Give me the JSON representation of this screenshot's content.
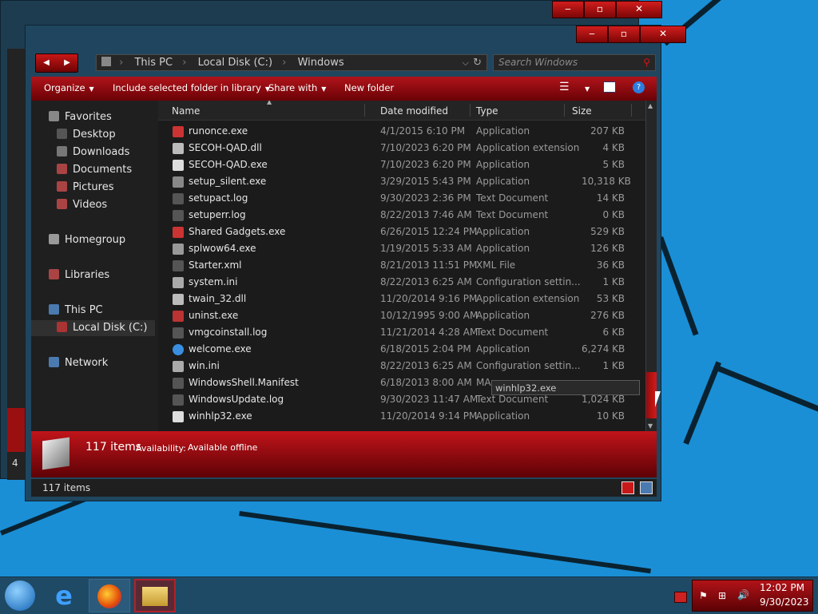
{
  "window": {
    "address": {
      "crumbs": [
        "This PC",
        "Local Disk (C:)",
        "Windows"
      ]
    },
    "search_placeholder": "Search Windows",
    "toolbar": {
      "organize": "Organize",
      "include": "Include selected folder in library",
      "share": "Share with",
      "new_folder": "New folder"
    },
    "nav": {
      "favorites": "Favorites",
      "desktop": "Desktop",
      "downloads": "Downloads",
      "documents": "Documents",
      "pictures": "Pictures",
      "videos": "Videos",
      "homegroup": "Homegroup",
      "libraries": "Libraries",
      "this_pc": "This PC",
      "local_disk": "Local Disk (C:)",
      "network": "Network"
    },
    "columns": {
      "name": "Name",
      "date": "Date modified",
      "type": "Type",
      "size": "Size"
    },
    "files": [
      {
        "name": "runonce.exe",
        "date": "4/1/2015 6:10 PM",
        "type": "Application",
        "size": "207 KB",
        "icon": "app-icon"
      },
      {
        "name": "SECOH-QAD.dll",
        "date": "7/10/2023 6:20 PM",
        "type": "Application extension",
        "size": "4 KB",
        "icon": "dll-icon"
      },
      {
        "name": "SECOH-QAD.exe",
        "date": "7/10/2023 6:20 PM",
        "type": "Application",
        "size": "5 KB",
        "icon": "window-app-icon"
      },
      {
        "name": "setup_silent.exe",
        "date": "3/29/2015 5:43 PM",
        "type": "Application",
        "size": "10,318 KB",
        "icon": "setup-icon"
      },
      {
        "name": "setupact.log",
        "date": "9/30/2023 2:36 PM",
        "type": "Text Document",
        "size": "14 KB",
        "icon": "text-icon"
      },
      {
        "name": "setuperr.log",
        "date": "8/22/2013 7:46 AM",
        "type": "Text Document",
        "size": "0 KB",
        "icon": "text-icon"
      },
      {
        "name": "Shared Gadgets.exe",
        "date": "6/26/2015 12:24 PM",
        "type": "Application",
        "size": "529 KB",
        "icon": "app-icon"
      },
      {
        "name": "splwow64.exe",
        "date": "1/19/2015 5:33 AM",
        "type": "Application",
        "size": "126 KB",
        "icon": "printer-icon"
      },
      {
        "name": "Starter.xml",
        "date": "8/21/2013 11:51 PM",
        "type": "XML File",
        "size": "36 KB",
        "icon": "text-icon"
      },
      {
        "name": "system.ini",
        "date": "8/22/2013 6:25 AM",
        "type": "Configuration settin...",
        "size": "1 KB",
        "icon": "config-icon"
      },
      {
        "name": "twain_32.dll",
        "date": "11/20/2014 9:16 PM",
        "type": "Application extension",
        "size": "53 KB",
        "icon": "dll-icon"
      },
      {
        "name": "uninst.exe",
        "date": "10/12/1995 9:00 AM",
        "type": "Application",
        "size": "276 KB",
        "icon": "uninstall-icon"
      },
      {
        "name": "vmgcoinstall.log",
        "date": "11/21/2014 4:28 AM",
        "type": "Text Document",
        "size": "6 KB",
        "icon": "text-icon"
      },
      {
        "name": "welcome.exe",
        "date": "6/18/2015 2:04 PM",
        "type": "Application",
        "size": "6,274 KB",
        "icon": "globe-icon"
      },
      {
        "name": "win.ini",
        "date": "8/22/2013 6:25 AM",
        "type": "Configuration settin...",
        "size": "1 KB",
        "icon": "config-icon"
      },
      {
        "name": "WindowsShell.Manifest",
        "date": "6/18/2013 8:00 AM",
        "type": "MA",
        "size": "",
        "icon": "text-icon"
      },
      {
        "name": "WindowsUpdate.log",
        "date": "9/30/2023 11:47 AM",
        "type": "Text Document",
        "size": "1,024 KB",
        "icon": "text-icon"
      },
      {
        "name": "winhlp32.exe",
        "date": "11/20/2014 9:14 PM",
        "type": "Application",
        "size": "10 KB",
        "icon": "window-app-icon"
      }
    ],
    "tooltip": "winhlp32.exe",
    "details": {
      "count": "117 items",
      "availability_label": "Availability:",
      "availability_value": "Available offline"
    },
    "status_count": "117 items"
  },
  "clock": {
    "time": "12:02 PM",
    "date": "9/30/2023"
  },
  "background_window": {
    "partial_text": "4"
  },
  "colors": {
    "accent_red": "#c0141a",
    "dark_panel": "#1b1b1b",
    "desktop_blue": "#1a8fd6"
  }
}
